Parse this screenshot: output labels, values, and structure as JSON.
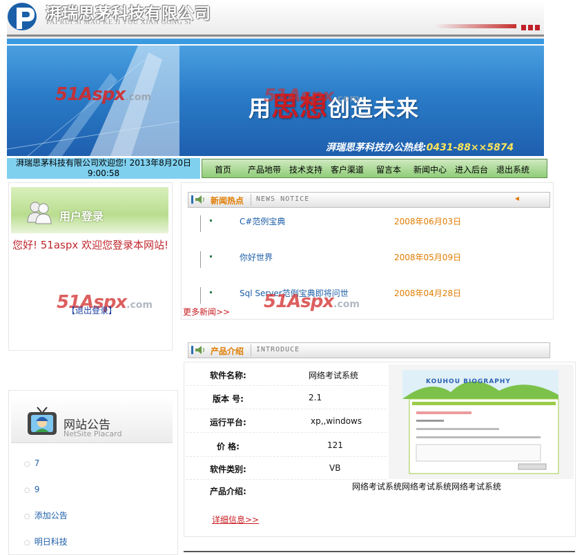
{
  "header": {
    "company_cn": "湃瑞思茅科技有限公司",
    "company_en": "PAI RUI SI MAO KE JI YOU XIAN GONG SI"
  },
  "banner": {
    "slogan_pre": "用",
    "slogan_red": "思想",
    "slogan_post": "创造未来",
    "hotline_label": "湃瑞思茅科技办公热线:",
    "hotline_number": "0431-88××5874",
    "watermark_brand": "51Aspx",
    "watermark_domain": ".com"
  },
  "welcome": {
    "text": "湃瑞思茅科技有限公司欢迎您!  2013年8月20日 9:00:58"
  },
  "nav": {
    "items": [
      "首页",
      "产品地带",
      "技术支持",
      "客户渠道",
      "留言本",
      "新闻中心",
      "进入后台",
      "退出系统"
    ]
  },
  "login": {
    "title": "用户登录",
    "welcome": "您好!   51aspx 欢迎您登录本网站!",
    "logout": "【退出登录】"
  },
  "notice": {
    "title": "网站公告",
    "subtitle": "NetSite Placard",
    "items": [
      "7",
      "9",
      "添加公告",
      "明日科技"
    ]
  },
  "news": {
    "title_cn": "新闻热点",
    "title_en": "NEWS NOTICE",
    "items": [
      {
        "title": "C#范例宝典",
        "date": "2008年06月03日"
      },
      {
        "title": "你好世界",
        "date": "2008年05月09日"
      },
      {
        "title": "Sql Server范例宝典即将问世",
        "date": "2008年04月28日"
      }
    ],
    "more": "更多新闻>>"
  },
  "product": {
    "title_cn": "产品介绍",
    "title_en": "INTRODUCE",
    "rows": [
      {
        "label": "软件名称:",
        "value": "网络考试系统"
      },
      {
        "label": "版本  号:",
        "value": "2.1"
      },
      {
        "label": "运行平台:",
        "value": "xp,,windows"
      },
      {
        "label": "价  格:",
        "value": "121"
      },
      {
        "label": "软件类别:",
        "value": "VB"
      },
      {
        "label": "产品介绍:",
        "value": ""
      }
    ],
    "description": "网络考试系统网络考试系统网络考试系统",
    "detail": "详细信息>>",
    "image_caption": "KOUHOU BIOGRAPHY"
  },
  "colors": {
    "nav_green": "#8fcd78",
    "welcome_blue": "#7fd0ef",
    "accent_orange": "#e07c00",
    "link_blue": "#1e5fa8",
    "accent_red": "#c81c22"
  }
}
